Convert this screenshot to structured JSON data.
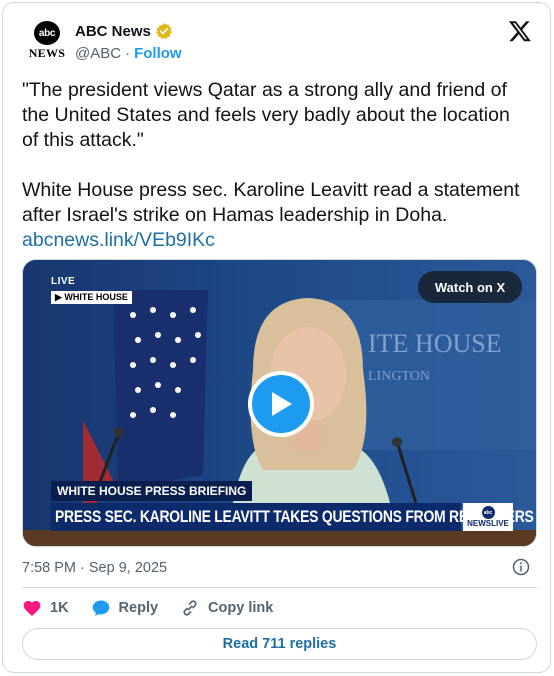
{
  "author": {
    "avatar_text": "abc",
    "avatar_word": "NEWS",
    "name": "ABC News",
    "handle": "@ABC",
    "separator": "·",
    "follow_label": "Follow"
  },
  "tweet": {
    "line1": "\"The president views Qatar as a strong ally and friend of",
    "line2": "the United States and feels very badly about the location",
    "line3": "of this attack.\"",
    "line4": "White House press sec. Karoline Leavitt read a statement",
    "line5": "after Israel's strike on Hamas leadership in Doha.",
    "link": "abcnews.link/VEb9IKc"
  },
  "media": {
    "live_label": "LIVE",
    "location_label": "▶ WHITE HOUSE",
    "watch_label": "Watch on X",
    "banner_top": "WHITE HOUSE PRESS BRIEFING",
    "banner_main": "PRESS SEC. KAROLINE LEAVITT TAKES QUESTIONS FROM REPORTERS",
    "news_badge_abc": "abc",
    "news_badge_text": "NEWSLIVE",
    "backdrop_text_1": "ITE HOUSE",
    "backdrop_text_2": "LINGTON"
  },
  "meta": {
    "timestamp": "7:58 PM · Sep 9, 2025"
  },
  "actions": {
    "likes": "1K",
    "reply_label": "Reply",
    "copy_label": "Copy link",
    "read_replies": "Read 711 replies"
  },
  "colors": {
    "accent": "#1d9bf0",
    "like": "#f91880",
    "link": "#1d6fa5"
  },
  "icons": [
    "verified-badge-icon",
    "x-logo-icon",
    "play-icon",
    "info-icon",
    "heart-icon",
    "reply-bubble-icon",
    "link-icon"
  ]
}
